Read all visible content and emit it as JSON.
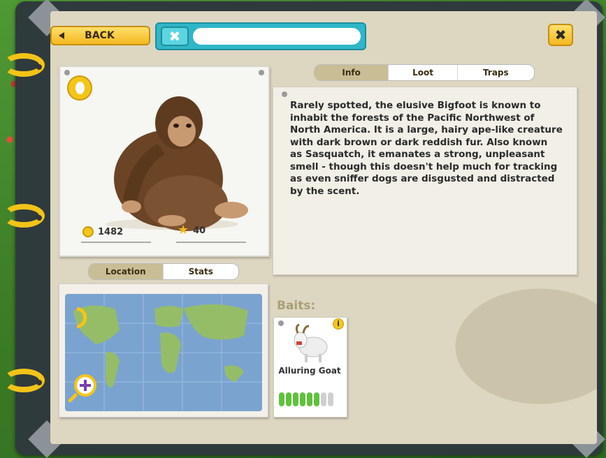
{
  "header": {
    "back_label": "BACK",
    "search_value": "",
    "clear_symbol": "✖",
    "close_symbol": "✖"
  },
  "creature": {
    "coins": "1482",
    "stars": "40",
    "description": "Rarely spotted, the elusive Bigfoot is known to inhabit the forests of the Pacific Northwest of North America. It is a large, hairy ape-like creature with dark brown or dark reddish fur. Also known as Sasquatch, it emanates a strong, unpleasant smell - though this doesn't help much for tracking as even sniffer dogs are disgusted and distracted by the scent."
  },
  "info_tabs": [
    {
      "label": "Info",
      "active": true
    },
    {
      "label": "Loot",
      "active": false
    },
    {
      "label": "Traps",
      "active": false
    }
  ],
  "map_tabs": [
    {
      "label": "Location",
      "active": true
    },
    {
      "label": "Stats",
      "active": false
    }
  ],
  "baits": {
    "title": "Baits:",
    "items": [
      {
        "name": "Alluring Goat",
        "info_symbol": "i",
        "progress": {
          "filled": 6,
          "total": 8
        }
      }
    ]
  },
  "colors": {
    "accent_yellow": "#f5c518",
    "teal": "#2fb6c8",
    "progress_green": "#5fc23c",
    "progress_empty": "#cfcfcf",
    "page_bg": "#ddd7c2"
  },
  "icons": [
    "arrow-left-icon",
    "close-icon",
    "footprint-icon",
    "coin-icon",
    "star-icon",
    "zoom-in-icon",
    "info-icon"
  ]
}
